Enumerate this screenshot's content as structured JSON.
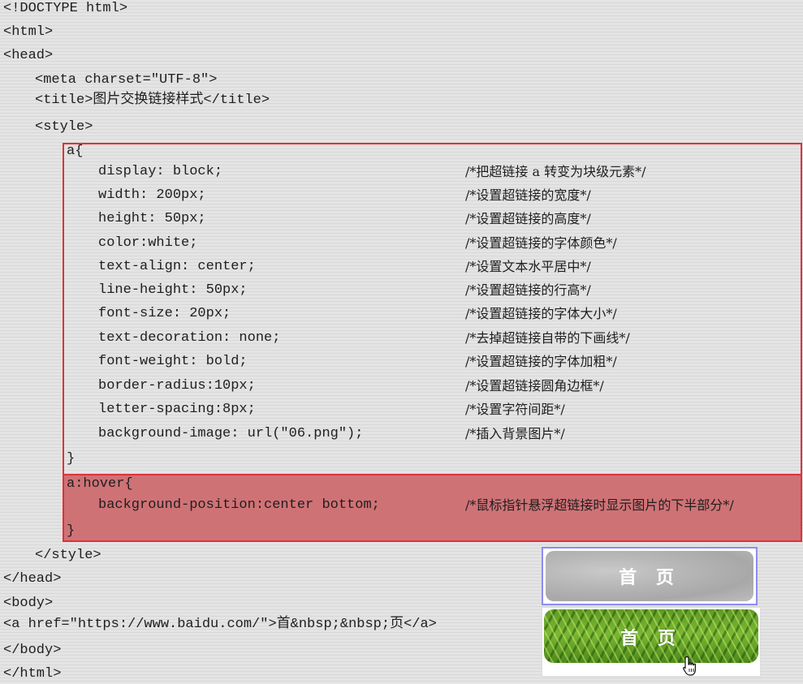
{
  "code": {
    "doctype": "<!DOCTYPE html>",
    "html_open": "<html>",
    "head_open": "<head>",
    "meta": "<meta charset=\"UTF-8\">",
    "title": "<title>图片交换链接样式</title>",
    "style_open": "<style>",
    "a_selector": "a{",
    "a_rules": [
      {
        "code": "display: block;",
        "comment": "/*把超链接 a 转变为块级元素*/"
      },
      {
        "code": "width: 200px;",
        "comment": "/*设置超链接的宽度*/"
      },
      {
        "code": "height: 50px;",
        "comment": "/*设置超链接的高度*/"
      },
      {
        "code": "color:white;",
        "comment": "/*设置超链接的字体颜色*/"
      },
      {
        "code": "text-align: center;",
        "comment": "/*设置文本水平居中*/"
      },
      {
        "code": "line-height: 50px;",
        "comment": "/*设置超链接的行高*/"
      },
      {
        "code": "font-size: 20px;",
        "comment": "/*设置超链接的字体大小*/"
      },
      {
        "code": "text-decoration: none;",
        "comment": "/*去掉超链接自带的下画线*/"
      },
      {
        "code": "font-weight: bold;",
        "comment": "/*设置超链接的字体加粗*/"
      },
      {
        "code": "border-radius:10px;",
        "comment": "/*设置超链接圆角边框*/"
      },
      {
        "code": "letter-spacing:8px;",
        "comment": "/*设置字符间距*/"
      },
      {
        "code": "background-image: url(\"06.png\");",
        "comment": "/*插入背景图片*/"
      }
    ],
    "a_close": "}",
    "hover_selector": "a:hover{",
    "hover_rule": {
      "code": "background-position:center bottom;",
      "comment": "/*鼠标指针悬浮超链接时显示图片的下半部分*/"
    },
    "hover_close": "}",
    "style_close": "</style>",
    "head_close": "</head>",
    "body_open": "<body>",
    "anchor": "<a href=\"https://www.baidu.com/\">首&nbsp;&nbsp;页</a>",
    "body_close": "</body>",
    "html_close": "</html>"
  },
  "preview": {
    "normal_label": "首  页",
    "hover_label": "首  页"
  },
  "colors": {
    "highlight_border": "#e0303a",
    "highlight_fill": "#cf7276",
    "preview_border": "#8c8cf0"
  },
  "icons": [
    "hand-pointer-icon"
  ]
}
